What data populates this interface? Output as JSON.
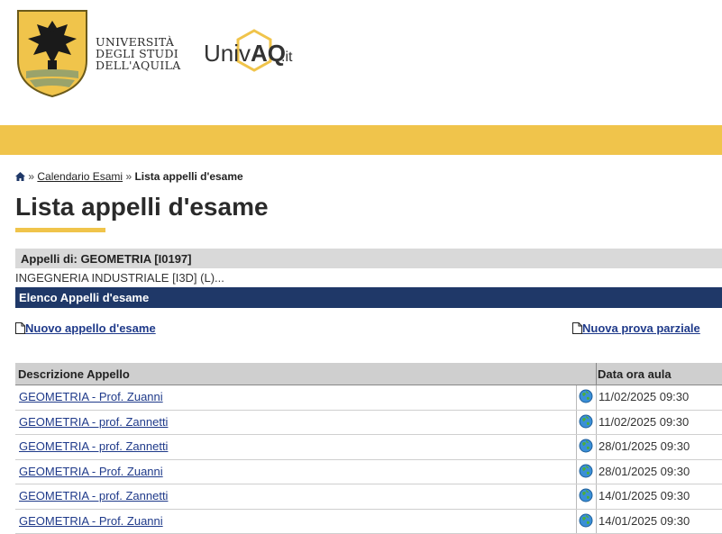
{
  "header": {
    "university_lines": [
      "UNIVERSITÀ",
      "DEGLI STUDI",
      "DELL'AQUILA"
    ],
    "portal_logo_text": {
      "main": "Univ",
      "accent": "AQ",
      "suffix": ".it"
    }
  },
  "colors": {
    "accent_yellow": "#f0c44b",
    "nav_blue": "#1f3868",
    "link_blue": "#1f3a8a"
  },
  "breadcrumb": {
    "home_icon": "home-icon",
    "separator": "»",
    "link": "Calendario Esami",
    "current": "Lista appelli d'esame"
  },
  "page_title": "Lista appelli d'esame",
  "course_bar": "Appelli di: GEOMETRIA [I0197]",
  "degree_course": "INGEGNERIA INDUSTRIALE [I3D] (L)...",
  "section_bar": "Elenco Appelli d'esame",
  "actions": {
    "new_exam": "Nuovo appello d'esame",
    "new_partial": "Nuova prova parziale"
  },
  "table": {
    "headers": [
      "Descrizione Appello",
      "Data ora aula"
    ],
    "rows": [
      {
        "description": "GEOMETRIA - Prof. Zuanni",
        "datetime": "11/02/2025 09:30"
      },
      {
        "description": "GEOMETRIA - prof. Zannetti",
        "datetime": "11/02/2025 09:30"
      },
      {
        "description": "GEOMETRIA - prof. Zannetti",
        "datetime": "28/01/2025 09:30"
      },
      {
        "description": "GEOMETRIA - Prof. Zuanni",
        "datetime": "28/01/2025 09:30"
      },
      {
        "description": "GEOMETRIA - prof. Zannetti",
        "datetime": "14/01/2025 09:30"
      },
      {
        "description": "GEOMETRIA - Prof. Zuanni",
        "datetime": "14/01/2025 09:30"
      }
    ]
  }
}
